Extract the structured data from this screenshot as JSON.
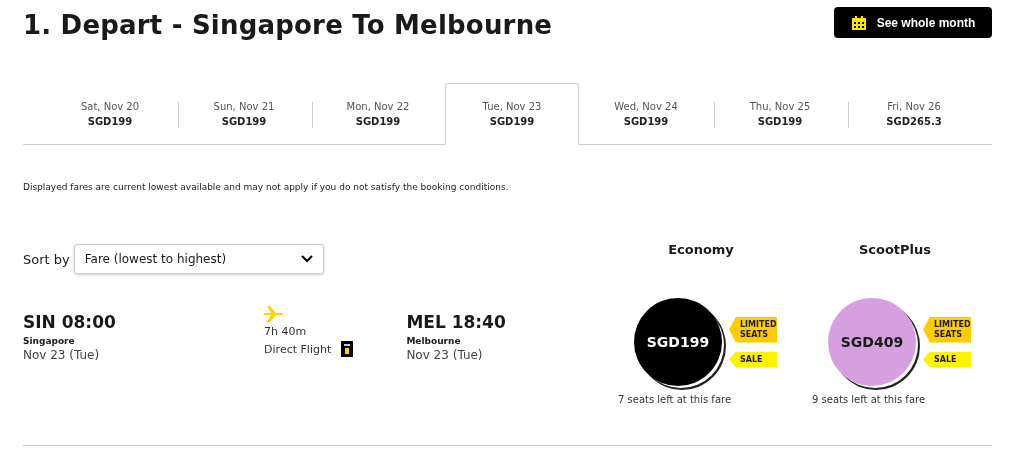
{
  "title": "1. Depart - Singapore To Melbourne",
  "month_button": {
    "label": "See whole month"
  },
  "date_tabs": [
    {
      "day": "Sat, Nov 20",
      "fare": "SGD199",
      "selected": false
    },
    {
      "day": "Sun, Nov 21",
      "fare": "SGD199",
      "selected": false
    },
    {
      "day": "Mon, Nov 22",
      "fare": "SGD199",
      "selected": false
    },
    {
      "day": "Tue, Nov 23",
      "fare": "SGD199",
      "selected": true
    },
    {
      "day": "Wed, Nov 24",
      "fare": "SGD199",
      "selected": false
    },
    {
      "day": "Thu, Nov 25",
      "fare": "SGD199",
      "selected": false
    },
    {
      "day": "Fri, Nov 26",
      "fare": "SGD265.3",
      "selected": false
    }
  ],
  "disclaimer": "Displayed fares are current lowest available and may not apply if you do not satisfy the booking conditions.",
  "sort": {
    "label": "Sort by",
    "value": "Fare (lowest to highest)"
  },
  "fare_classes": [
    "Economy",
    "ScootPlus"
  ],
  "flight": {
    "departure": {
      "time": "SIN 08:00",
      "city": "Singapore",
      "date": "Nov 23 (Tue)"
    },
    "duration": "7h 40m",
    "stops": "Direct Flight",
    "arrival": {
      "time": "MEL 18:40",
      "city": "Melbourne",
      "date": "Nov 23 (Tue)"
    },
    "fares": [
      {
        "price": "SGD199",
        "color": "#000000",
        "seats": "7 seats left at this fare",
        "tags": [
          {
            "label": "LIMITED SEATS",
            "color": "#ffcc00"
          },
          {
            "label": "SALE",
            "color": "#fff200"
          }
        ]
      },
      {
        "price": "SGD409",
        "color": "#d6a0e0",
        "seats": "9 seats left at this fare",
        "tags": [
          {
            "label": "LIMITED SEATS",
            "color": "#ffcc00"
          },
          {
            "label": "SALE",
            "color": "#fff200"
          }
        ]
      }
    ]
  }
}
